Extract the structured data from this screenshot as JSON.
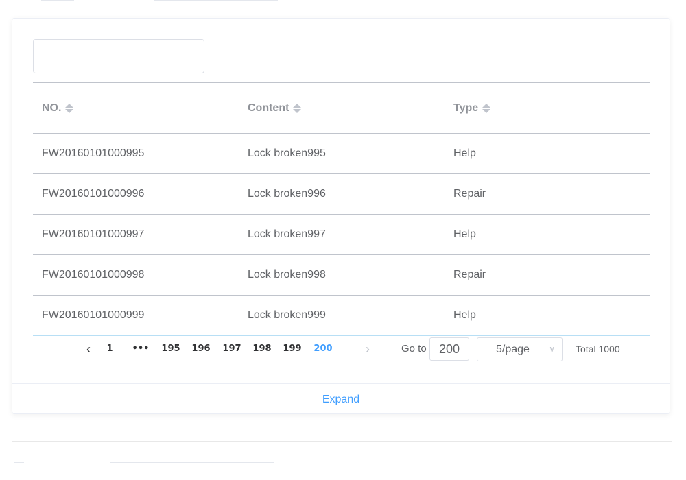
{
  "search": {
    "value": "",
    "placeholder": ""
  },
  "table": {
    "columns": [
      {
        "label": "NO."
      },
      {
        "label": "Content"
      },
      {
        "label": "Type"
      }
    ],
    "rows": [
      {
        "no": "FW20160101000995",
        "content": "Lock broken995",
        "type": "Help"
      },
      {
        "no": "FW20160101000996",
        "content": "Lock broken996",
        "type": "Repair"
      },
      {
        "no": "FW20160101000997",
        "content": "Lock broken997",
        "type": "Help"
      },
      {
        "no": "FW20160101000998",
        "content": "Lock broken998",
        "type": "Repair"
      },
      {
        "no": "FW20160101000999",
        "content": "Lock broken999",
        "type": "Help"
      }
    ]
  },
  "pagination": {
    "prev_icon": "‹",
    "next_icon": "›",
    "first_page": "1",
    "ellipsis": "•••",
    "pages": [
      "195",
      "196",
      "197",
      "198",
      "199",
      "200"
    ],
    "current_page": "200",
    "goto_label": "Go to",
    "goto_value": "200",
    "page_size": "5/page",
    "total": "Total 1000"
  },
  "footer": {
    "expand_label": "Expand"
  },
  "colors": {
    "accent": "#409eff",
    "text": "#606266",
    "header_text": "#909399",
    "border": "#c0c4cc"
  }
}
